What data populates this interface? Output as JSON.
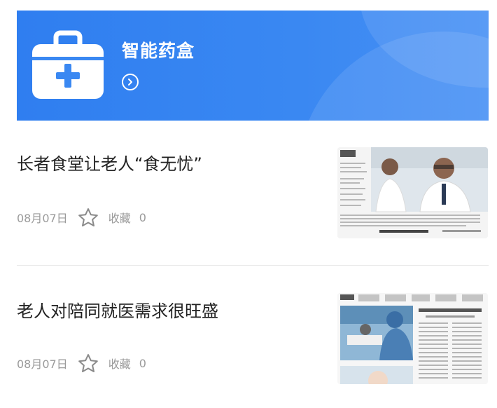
{
  "banner": {
    "title": "智能药盒",
    "icon": "medicine-box-icon",
    "arrow_icon": "chevron-right-circle-icon",
    "colors": {
      "start": "#2f7ef0",
      "end": "#4790f4"
    }
  },
  "articles": [
    {
      "title": "长者食堂让老人“食无忧”",
      "date": "08月07日",
      "favorite_label": "收藏",
      "favorite_count": "0",
      "thumbnail_icon": "newspaper-thumbnail"
    },
    {
      "title": "老人对陪同就医需求很旺盛",
      "date": "08月07日",
      "favorite_label": "收藏",
      "favorite_count": "0",
      "thumbnail_icon": "newspaper-thumbnail"
    }
  ]
}
